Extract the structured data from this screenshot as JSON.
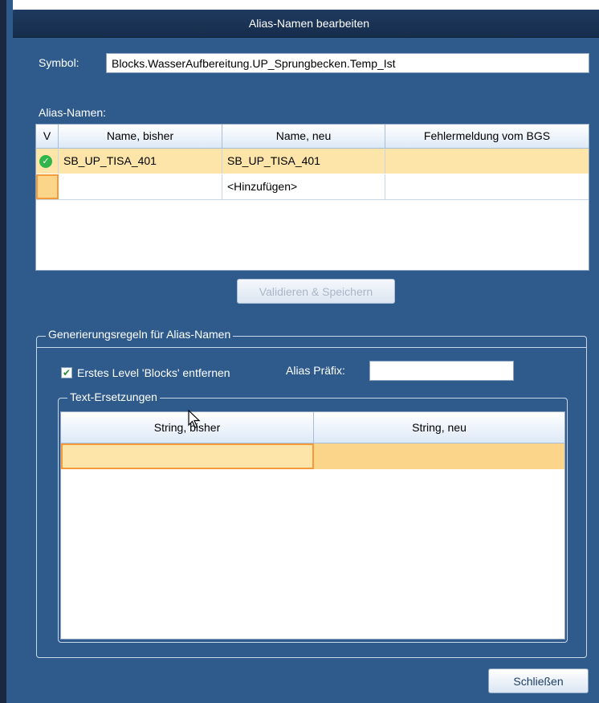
{
  "window": {
    "title": "Alias-Namen bearbeiten"
  },
  "symbol": {
    "label": "Symbol:",
    "value": "Blocks.WasserAufbereitung.UP_Sprungbecken.Temp_Ist"
  },
  "alias_section": {
    "label": "Alias-Namen:",
    "columns": [
      "V",
      "Name, bisher",
      "Name, neu",
      "Fehlermeldung vom BGS"
    ],
    "rows": [
      {
        "status_icon": "check-circle-icon",
        "name_old": "SB_UP_TISA_401",
        "name_new": "SB_UP_TISA_401",
        "error": ""
      },
      {
        "status_icon": "",
        "name_old": "",
        "name_new": "<Hinzufügen>",
        "error": ""
      }
    ],
    "validate_button": "Validieren & Speichern"
  },
  "rules_group": {
    "label": "Generierungsregeln für Alias-Namen",
    "remove_first_level": {
      "label": "Erstes Level 'Blocks' entfernen",
      "checked": true
    },
    "alias_prefix": {
      "label": "Alias Präfix:",
      "value": ""
    },
    "replacements": {
      "label": "Text-Ersetzungen",
      "columns": [
        "String, bisher",
        "String, neu"
      ]
    }
  },
  "close_button": "Schließen",
  "colors": {
    "background": "#2f5b8c",
    "titlebar": "#1f3a5f",
    "row_selected": "#fde4a8",
    "accent_orange": "#f49a3a",
    "check_green": "#2fb54a"
  }
}
